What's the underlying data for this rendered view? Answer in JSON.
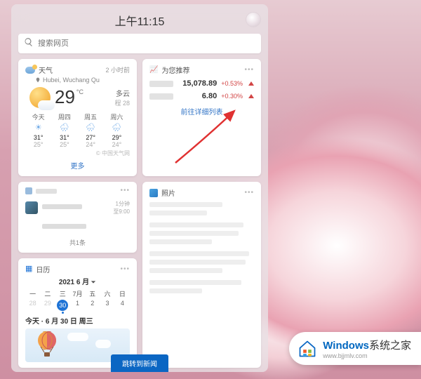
{
  "clock": "上午11:15",
  "search": {
    "placeholder": "搜索网页"
  },
  "weather": {
    "title": "天气",
    "ago": "2 小时前",
    "location": "Hubei, Wuchang Qu",
    "temp": "29",
    "unit": "°C",
    "condition": "多云",
    "aqi": "程 28",
    "forecast": [
      {
        "day": "今天",
        "hi": "31°",
        "lo": "25°"
      },
      {
        "day": "周四",
        "hi": "31°",
        "lo": "25°"
      },
      {
        "day": "周五",
        "hi": "27°",
        "lo": "24°"
      },
      {
        "day": "周六",
        "hi": "29°",
        "lo": "24°"
      }
    ],
    "attribution": "© 中国天气网",
    "more": "更多"
  },
  "stocks": {
    "title": "为您推荐",
    "rows": [
      {
        "value": "15,078.89",
        "pct": "+0.53%"
      },
      {
        "value": "6.80",
        "pct": "+0.30%"
      }
    ],
    "link": "前往详细列表"
  },
  "photos": {
    "title": "照片"
  },
  "todo": {
    "time": "1分钟\n至9:00",
    "footer": "共1条"
  },
  "calendar": {
    "title": "日历",
    "month": "2021 6 月",
    "weekdays": [
      "一",
      "二",
      "三",
      "7月",
      "五",
      "六",
      "日"
    ],
    "row1": [
      "28",
      "29",
      "30",
      "1",
      "2",
      "3",
      "4"
    ],
    "todayLine": "今天 · 6 月 30 日 周三"
  },
  "jumpButton": "跳转到新闻",
  "watermark": {
    "brand": "Windows",
    "suffix": "系统之家",
    "url": "www.bjjmlv.com"
  }
}
